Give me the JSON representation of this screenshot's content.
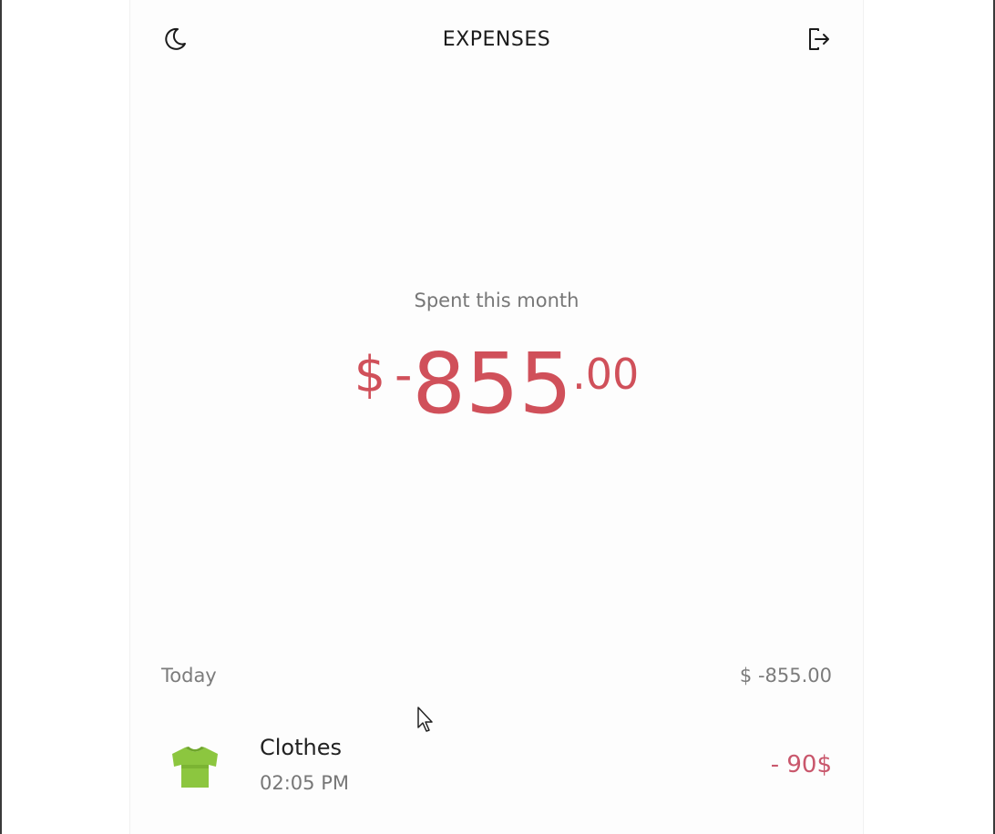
{
  "header": {
    "title": "EXPENSES",
    "left_icon": "moon-icon",
    "right_icon": "logout-icon"
  },
  "summary": {
    "label": "Spent this month",
    "currency": "$",
    "sign": "-",
    "integer": "855",
    "decimal": ".00",
    "color": "#d0505a"
  },
  "group": {
    "day": "Today",
    "total": "$ -855.00"
  },
  "transactions": [
    {
      "icon": "shirt-icon",
      "name": "Clothes",
      "time": "02:05 PM",
      "amount": "- 90$",
      "icon_color": "#8cc63f"
    }
  ]
}
